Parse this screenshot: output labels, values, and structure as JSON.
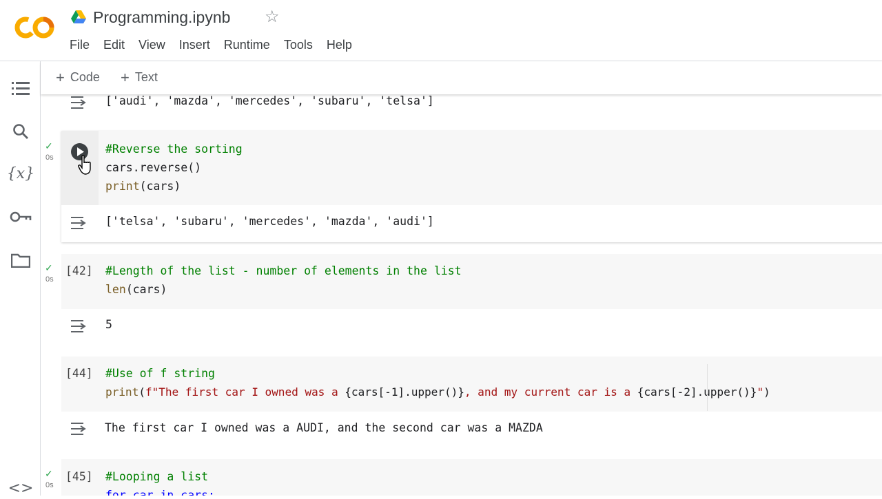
{
  "app": {
    "logo_text": "CO",
    "title": "Programming.ipynb",
    "menu": [
      "File",
      "Edit",
      "View",
      "Insert",
      "Runtime",
      "Tools",
      "Help"
    ]
  },
  "toolbar": {
    "code_label": "Code",
    "text_label": "Text"
  },
  "sidebar": {
    "icons": [
      "table-of-contents-icon",
      "search-icon",
      "variables-icon",
      "secrets-key-icon",
      "files-folder-icon",
      "code-snippets-icon"
    ]
  },
  "cells": {
    "prev_output": "['audi', 'mazda', 'mercedes', 'subaru', 'telsa']",
    "reverse": {
      "check": "✓",
      "time": "0s",
      "line1": "#Reverse the sorting",
      "line2_a": "cars.reverse",
      "line2_b": "()",
      "line3_a": "print",
      "line3_b": "(cars)",
      "output": "['telsa', 'subaru', 'mercedes', 'mazda', 'audi']"
    },
    "length": {
      "check": "✓",
      "time": "0s",
      "count": "[42]",
      "line1": "#Length of the list - number of elements in the list",
      "line2_a": "len",
      "line2_b": "(cars)",
      "output": "5"
    },
    "fstring": {
      "count": "[44]",
      "line1": "#Use of f string",
      "line2_fn": "print",
      "line2_open": "(",
      "line2_str1": "f\"The first car I owned was a ",
      "line2_expr1": "{cars[-1].upper()}",
      "line2_str2": ", and my current car is a ",
      "line2_expr2": "{cars[-2].upper()}",
      "line2_str3": "\"",
      "line2_close": ")",
      "output": "The first car I owned was a AUDI, and the second car was a MAZDA"
    },
    "loop": {
      "check": "✓",
      "time": "0s",
      "count": "[45]",
      "line1": "#Looping a list",
      "line2": "for car in cars:"
    }
  },
  "colors": {
    "logo_orange": "#F9AB00",
    "logo_dark": "#E8710A",
    "check_green": "#34A853",
    "comment_green": "#008000",
    "string_red": "#A31515"
  }
}
